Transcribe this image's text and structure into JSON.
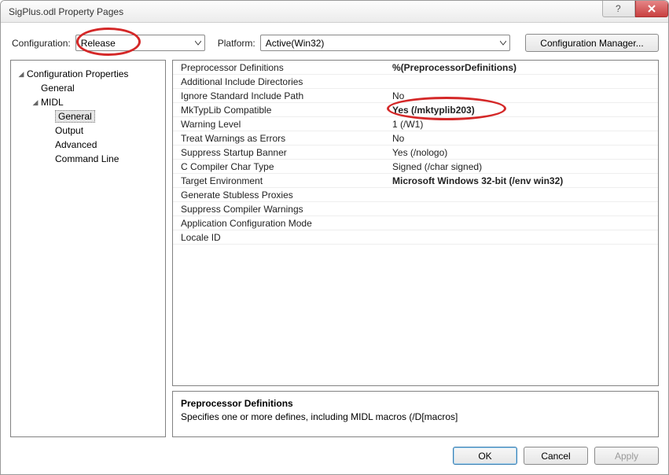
{
  "window": {
    "title": "SigPlus.odl Property Pages"
  },
  "toolbar": {
    "config_label": "Configuration:",
    "config_value": "Release",
    "platform_label": "Platform:",
    "platform_value": "Active(Win32)",
    "cfgmgr_label": "Configuration Manager..."
  },
  "tree": {
    "root": "Configuration Properties",
    "items": [
      "General",
      "MIDL"
    ],
    "midl_items": [
      "General",
      "Output",
      "Advanced",
      "Command Line"
    ]
  },
  "grid_rows": [
    {
      "k": "Preprocessor Definitions",
      "v": "%(PreprocessorDefinitions)",
      "bold": true
    },
    {
      "k": "Additional Include Directories",
      "v": ""
    },
    {
      "k": "Ignore Standard Include Path",
      "v": "No"
    },
    {
      "k": "MkTypLib Compatible",
      "v": "Yes (/mktyplib203)",
      "bold": true,
      "circle": true
    },
    {
      "k": "Warning Level",
      "v": "1 (/W1)"
    },
    {
      "k": "Treat Warnings as Errors",
      "v": "No"
    },
    {
      "k": "Suppress Startup Banner",
      "v": "Yes (/nologo)"
    },
    {
      "k": "C Compiler Char Type",
      "v": "Signed (/char signed)"
    },
    {
      "k": "Target Environment",
      "v": "Microsoft Windows 32-bit (/env win32)",
      "bold": true
    },
    {
      "k": "Generate Stubless Proxies",
      "v": ""
    },
    {
      "k": "Suppress Compiler Warnings",
      "v": ""
    },
    {
      "k": "Application Configuration Mode",
      "v": ""
    },
    {
      "k": "Locale ID",
      "v": ""
    }
  ],
  "desc": {
    "title": "Preprocessor Definitions",
    "body": "Specifies one or more defines, including MIDL macros (/D[macros]"
  },
  "footer": {
    "ok": "OK",
    "cancel": "Cancel",
    "apply": "Apply"
  }
}
